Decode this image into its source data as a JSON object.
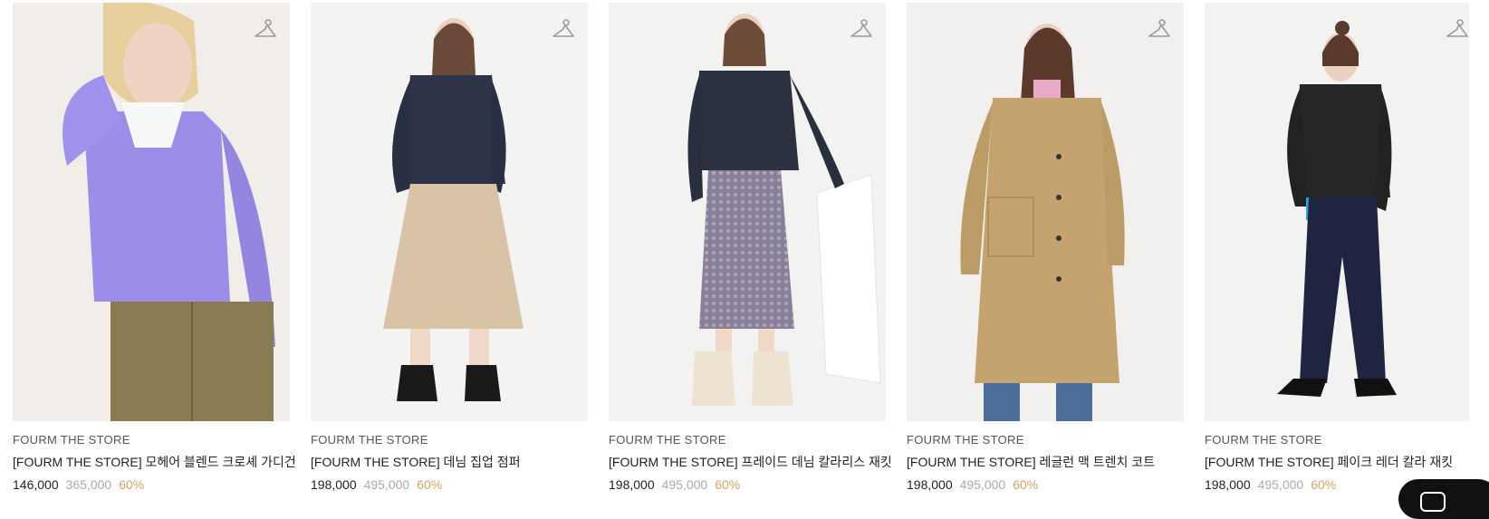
{
  "products": [
    {
      "brand": "FOURM THE STORE",
      "title": "[FOURM THE STORE] 모헤어 블렌드 크로셰 가디건",
      "price": "146,000",
      "original_price": "365,000",
      "discount": "60%"
    },
    {
      "brand": "FOURM THE STORE",
      "title": "[FOURM THE STORE] 데님 집업 점퍼",
      "price": "198,000",
      "original_price": "495,000",
      "discount": "60%"
    },
    {
      "brand": "FOURM THE STORE",
      "title": "[FOURM THE STORE] 프레이드 데님 칼라리스 재킷",
      "price": "198,000",
      "original_price": "495,000",
      "discount": "60%"
    },
    {
      "brand": "FOURM THE STORE",
      "title": "[FOURM THE STORE] 레글런 맥 트렌치 코트",
      "price": "198,000",
      "original_price": "495,000",
      "discount": "60%"
    },
    {
      "brand": "FOURM THE STORE",
      "title": "[FOURM THE STORE] 페이크 레더 칼라 재킷",
      "price": "198,000",
      "original_price": "495,000",
      "discount": "60%"
    }
  ],
  "icons": {
    "wishlist": "hanger-icon",
    "chat": "chat-icon"
  },
  "colors": {
    "discount": "#d4a55a",
    "original_price": "#aaaaaa",
    "text": "#222222"
  }
}
